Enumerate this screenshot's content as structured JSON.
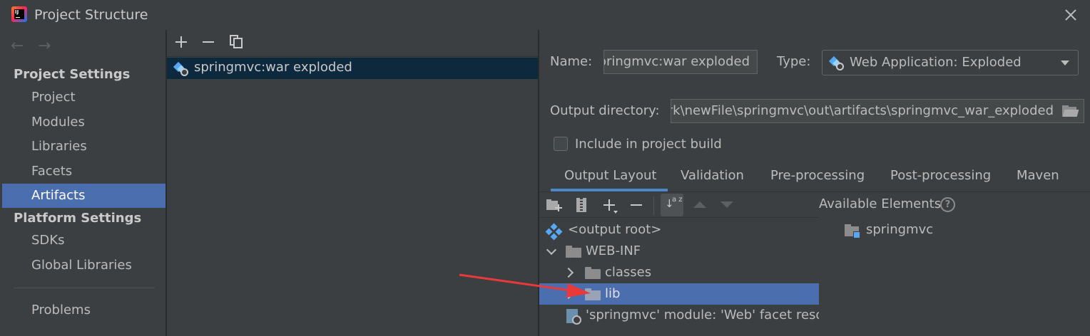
{
  "window": {
    "title": "Project Structure",
    "icon_text": "IJ"
  },
  "nav": {
    "back_icon": "←",
    "forward_icon": "→"
  },
  "sidebar": {
    "project_settings_title": "Project Settings",
    "project_items": [
      "Project",
      "Modules",
      "Libraries",
      "Facets",
      "Artifacts"
    ],
    "selected_item": "Artifacts",
    "platform_settings_title": "Platform Settings",
    "platform_items": [
      "SDKs",
      "Global Libraries"
    ],
    "problems_label": "Problems"
  },
  "artifacts": {
    "list": [
      "springmvc:war exploded"
    ]
  },
  "detail": {
    "name_label": "Name:",
    "name_value": "springmvc:war exploded",
    "type_label": "Type:",
    "type_value": "Web Application: Exploded",
    "output_directory_label": "Output directory:",
    "output_directory_value": "C:\\work\\newFile\\springmvc\\out\\artifacts\\springmvc_war_exploded",
    "include_in_build_label": "Include in project build",
    "include_in_build_checked": false,
    "tabs": [
      "Output Layout",
      "Validation",
      "Pre-processing",
      "Post-processing",
      "Maven"
    ],
    "active_tab": "Output Layout"
  },
  "output_layout": {
    "sort_icon_text": "a z",
    "tree": [
      {
        "label": "<output root>",
        "icon": "output-root-icon",
        "level": 0,
        "expander": "none"
      },
      {
        "label": "WEB-INF",
        "icon": "folder-icon",
        "level": 0,
        "expander": "expanded"
      },
      {
        "label": "classes",
        "icon": "folder-icon",
        "level": 1,
        "expander": "collapsed"
      },
      {
        "label": "lib",
        "icon": "folder-icon",
        "level": 1,
        "expander": "collapsed",
        "selected": true
      },
      {
        "label": "'springmvc' module: 'Web' facet resources",
        "icon": "web-facet-icon",
        "level": 0,
        "expander": "none"
      }
    ]
  },
  "available_elements": {
    "title": "Available Elements",
    "help_icon_text": "?",
    "items": [
      "springmvc"
    ]
  },
  "annotation": {
    "color": "#e83a3a",
    "target": "lib"
  },
  "colors": {
    "background": "#3c3f41",
    "selection": "#4b6eaf",
    "list_selection": "#0d293e",
    "tab_underline": "#4a88c7",
    "text": "#bbbbbb"
  }
}
